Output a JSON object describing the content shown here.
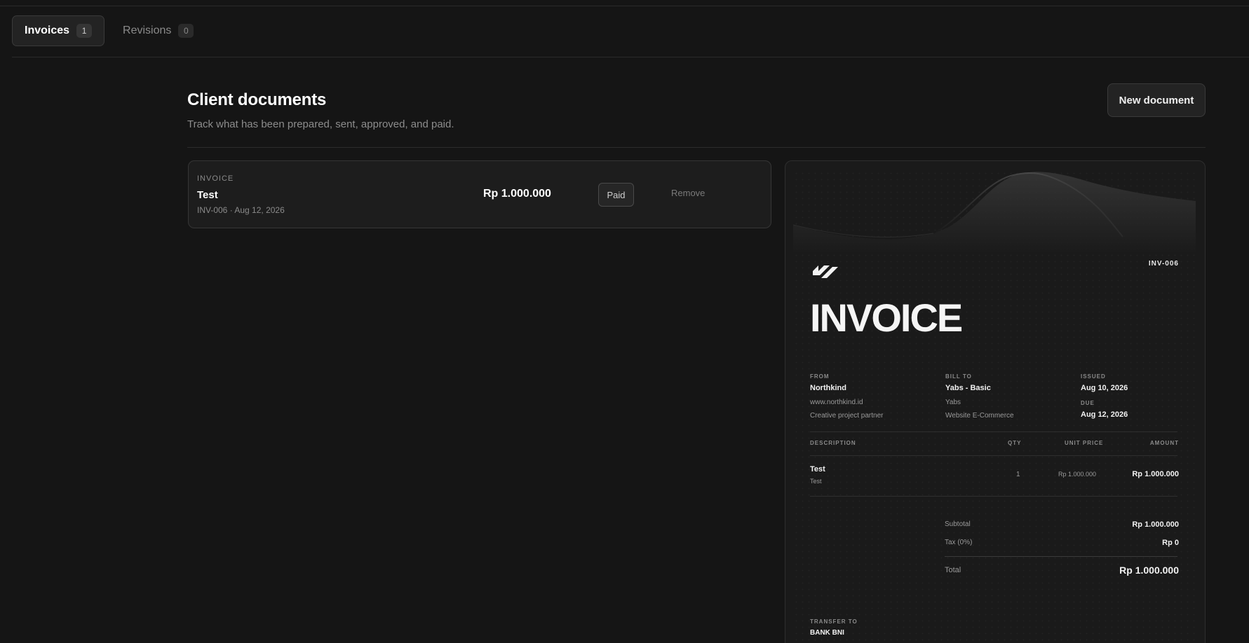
{
  "tabs": [
    {
      "label": "Invoices",
      "count": "1"
    },
    {
      "label": "Revisions",
      "count": "0"
    }
  ],
  "header": {
    "title": "Client documents",
    "subtitle": "Track what has been prepared, sent, approved, and paid.",
    "new_button": "New document"
  },
  "documents": [
    {
      "type": "INVOICE",
      "name": "Test",
      "meta": "INV-006 · Aug 12, 2026",
      "amount": "Rp 1.000.000",
      "status": "Paid",
      "remove_label": "Remove"
    }
  ],
  "preview": {
    "number": "INV-006",
    "title": "INVOICE",
    "from": {
      "label": "FROM",
      "name": "Northkind",
      "line1": "www.northkind.id",
      "line2": "Creative project partner"
    },
    "bill_to": {
      "label": "BILL TO",
      "name": "Yabs - Basic",
      "line1": "Yabs",
      "line2": "Website E-Commerce"
    },
    "issued": {
      "label": "ISSUED",
      "value": "Aug 10, 2026"
    },
    "due": {
      "label": "DUE",
      "value": "Aug 12, 2026"
    },
    "table_headers": {
      "description": "DESCRIPTION",
      "qty": "QTY",
      "unit_price": "UNIT PRICE",
      "amount": "AMOUNT"
    },
    "items": [
      {
        "name": "Test",
        "desc": "Test",
        "qty": "1",
        "unit_price": "Rp 1.000.000",
        "amount": "Rp 1.000.000"
      }
    ],
    "totals": {
      "subtotal_label": "Subtotal",
      "subtotal": "Rp 1.000.000",
      "tax_label": "Tax (0%)",
      "tax": "Rp 0",
      "total_label": "Total",
      "total": "Rp 1.000.000"
    },
    "transfer": {
      "label": "TRANSFER TO",
      "bank": "BANK BNI"
    }
  }
}
